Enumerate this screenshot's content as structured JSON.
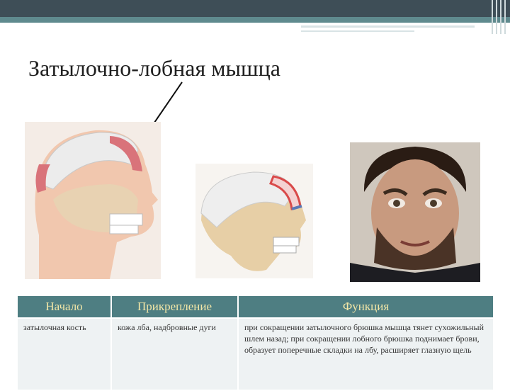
{
  "slide": {
    "title": "Затылочно-лобная мышца"
  },
  "table": {
    "headers": [
      "Начало",
      "Прикрепление",
      "Функция"
    ],
    "row": [
      "затылочная кость",
      "кожа лба, надбровные дуги",
      "при сокращении затылочного брюшка мышца тянет сухожильный шлем назад; при сокращении лобного брюшка поднимает брови, образует поперечные складки на лбу, расширяет глазную щель"
    ]
  },
  "colors": {
    "header_bg": "#4e7e82",
    "header_text": "#f3e7a7",
    "cell_bg": "#eef2f3",
    "topbar": "#3e4e57",
    "accent": "#5f8a8e"
  }
}
